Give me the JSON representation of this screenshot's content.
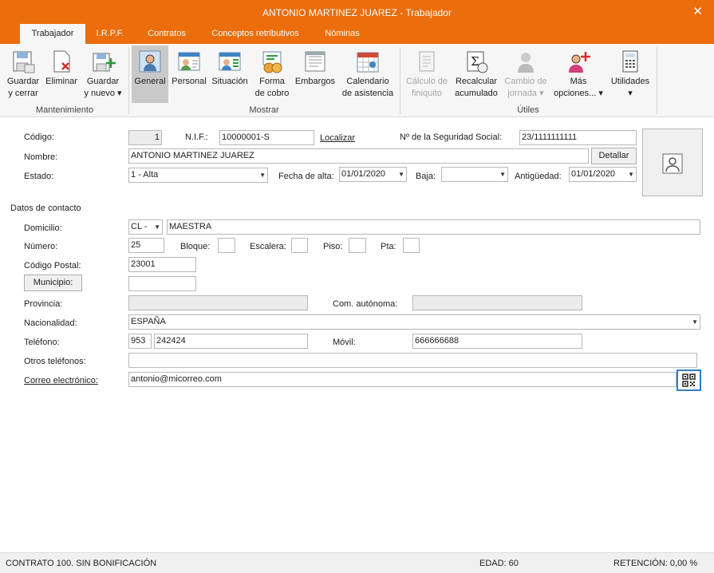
{
  "window": {
    "title": "ANTONIO MARTINEZ JUAREZ - Trabajador",
    "close_icon": "close-icon"
  },
  "tabs": [
    "Trabajador",
    "I.R.P.F.",
    "Contratos",
    "Conceptos retributivos",
    "Nóminas"
  ],
  "ribbon": {
    "mantenimiento": {
      "label": "Mantenimiento",
      "guardar_cerrar": [
        "Guardar",
        "y cerrar"
      ],
      "eliminar": "Eliminar",
      "guardar_nuevo": [
        "Guardar",
        "y nuevo ▾"
      ]
    },
    "mostrar": {
      "label": "Mostrar",
      "general": "General",
      "personal": "Personal",
      "situacion": "Situación",
      "forma_cobro": [
        "Forma",
        "de cobro"
      ],
      "embargos": "Embargos",
      "calendario": [
        "Calendario",
        "de asistencia"
      ]
    },
    "utiles": {
      "label": "Útiles",
      "calculo": [
        "Cálculo de",
        "finiquito"
      ],
      "recalcular": [
        "Recalcular",
        "acumulado"
      ],
      "cambio": [
        "Cambio de",
        "jornada ▾"
      ],
      "mas": [
        "Más",
        "opciones... ▾"
      ],
      "utilidades": [
        "Utilidades",
        "▾"
      ]
    }
  },
  "form": {
    "codigo_label": "Código:",
    "codigo": "1",
    "nif_label": "N.I.F.:",
    "nif": "10000001-S",
    "localizar": "Localizar",
    "ss_label": "Nº de la Seguridad Social:",
    "ss": "23/1111111111",
    "nombre_label": "Nombre:",
    "nombre": "ANTONIO MARTINEZ JUAREZ",
    "detallar": "Detallar",
    "estado_label": "Estado:",
    "estado": "1 - Alta",
    "fecha_alta_label": "Fecha de alta:",
    "fecha_alta": "01/01/2020",
    "baja_label": "Baja:",
    "baja": "",
    "antiguedad_label": "Antigüedad:",
    "antiguedad": "01/01/2020",
    "photo_icon": "person-icon"
  },
  "contacto": {
    "section": "Datos de contacto",
    "domicilio_label": "Domicilio:",
    "via": "CL -",
    "domicilio": "MAESTRA",
    "numero_label": "Número:",
    "numero": "25",
    "bloque_label": "Bloque:",
    "bloque": "",
    "escalera_label": "Escalera:",
    "escalera": "",
    "piso_label": "Piso:",
    "piso": "",
    "pta_label": "Pta:",
    "pta": "",
    "cp_label": "Código Postal:",
    "cp": "23001",
    "municipio": "Municipio:",
    "municipio_value": "",
    "provincia_label": "Provincia:",
    "provincia": "",
    "com_label": "Com. autónoma:",
    "com": "",
    "nacionalidad_label": "Nacionalidad:",
    "nacionalidad": "ESPAÑA",
    "telefono_label": "Teléfono:",
    "tel_prefijo": "953",
    "telefono": "242424",
    "movil_label": "Móvil:",
    "movil": "666666688",
    "otros_label": "Otros teléfonos:",
    "otros": "",
    "correo_label": "Correo electrónico:",
    "correo": "antonio@micorreo.com",
    "qr_icon": "qr-icon"
  },
  "status": {
    "contrato": "CONTRATO 100.  SIN BONIFICACIÓN",
    "edad": "EDAD: 60",
    "retencion": "RETENCIÓN: 0,00 %"
  }
}
